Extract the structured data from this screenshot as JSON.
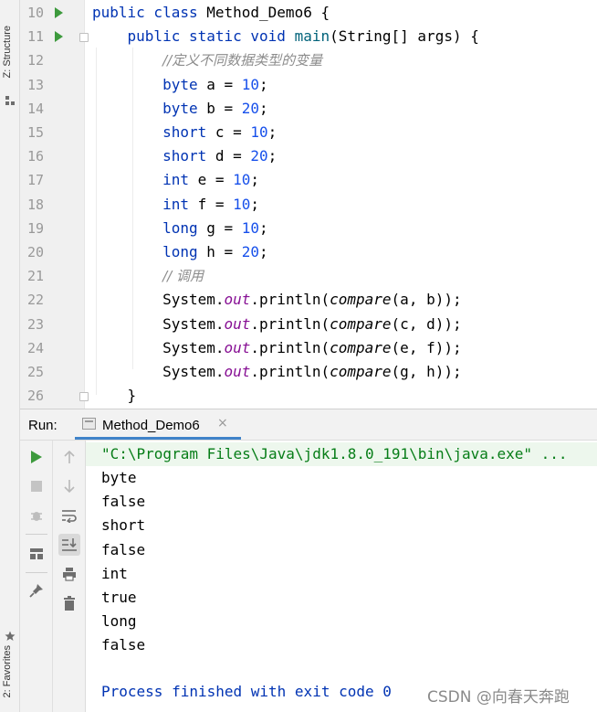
{
  "side_tabs": {
    "structure": "Z: Structure",
    "favorites": "2: Favorites"
  },
  "editor": {
    "lines": [
      {
        "num": "10",
        "run": true,
        "fold": false,
        "code": [
          {
            "t": "kw",
            "v": "public class "
          },
          {
            "t": "p",
            "v": "Method_Demo6 {"
          }
        ]
      },
      {
        "num": "11",
        "run": true,
        "fold": true,
        "code": [
          {
            "t": "p",
            "v": "    "
          },
          {
            "t": "kw",
            "v": "public static void "
          },
          {
            "t": "mth",
            "v": "main"
          },
          {
            "t": "p",
            "v": "(String[] args) {"
          }
        ]
      },
      {
        "num": "12",
        "run": false,
        "fold": false,
        "code": [
          {
            "t": "p",
            "v": "        "
          },
          {
            "t": "cmt",
            "v": "//定义不同数据类型的变量"
          }
        ]
      },
      {
        "num": "13",
        "run": false,
        "fold": false,
        "code": [
          {
            "t": "p",
            "v": "        "
          },
          {
            "t": "kw",
            "v": "byte "
          },
          {
            "t": "p",
            "v": "a = "
          },
          {
            "t": "num",
            "v": "10"
          },
          {
            "t": "p",
            "v": ";"
          }
        ]
      },
      {
        "num": "14",
        "run": false,
        "fold": false,
        "code": [
          {
            "t": "p",
            "v": "        "
          },
          {
            "t": "kw",
            "v": "byte "
          },
          {
            "t": "p",
            "v": "b = "
          },
          {
            "t": "num",
            "v": "20"
          },
          {
            "t": "p",
            "v": ";"
          }
        ]
      },
      {
        "num": "15",
        "run": false,
        "fold": false,
        "code": [
          {
            "t": "p",
            "v": "        "
          },
          {
            "t": "kw",
            "v": "short "
          },
          {
            "t": "p",
            "v": "c = "
          },
          {
            "t": "num",
            "v": "10"
          },
          {
            "t": "p",
            "v": ";"
          }
        ]
      },
      {
        "num": "16",
        "run": false,
        "fold": false,
        "code": [
          {
            "t": "p",
            "v": "        "
          },
          {
            "t": "kw",
            "v": "short "
          },
          {
            "t": "p",
            "v": "d = "
          },
          {
            "t": "num",
            "v": "20"
          },
          {
            "t": "p",
            "v": ";"
          }
        ]
      },
      {
        "num": "17",
        "run": false,
        "fold": false,
        "code": [
          {
            "t": "p",
            "v": "        "
          },
          {
            "t": "kw",
            "v": "int "
          },
          {
            "t": "p",
            "v": "e = "
          },
          {
            "t": "num",
            "v": "10"
          },
          {
            "t": "p",
            "v": ";"
          }
        ]
      },
      {
        "num": "18",
        "run": false,
        "fold": false,
        "code": [
          {
            "t": "p",
            "v": "        "
          },
          {
            "t": "kw",
            "v": "int "
          },
          {
            "t": "p",
            "v": "f = "
          },
          {
            "t": "num",
            "v": "10"
          },
          {
            "t": "p",
            "v": ";"
          }
        ]
      },
      {
        "num": "19",
        "run": false,
        "fold": false,
        "code": [
          {
            "t": "p",
            "v": "        "
          },
          {
            "t": "kw",
            "v": "long "
          },
          {
            "t": "p",
            "v": "g = "
          },
          {
            "t": "num",
            "v": "10"
          },
          {
            "t": "p",
            "v": ";"
          }
        ]
      },
      {
        "num": "20",
        "run": false,
        "fold": false,
        "code": [
          {
            "t": "p",
            "v": "        "
          },
          {
            "t": "kw",
            "v": "long "
          },
          {
            "t": "p",
            "v": "h = "
          },
          {
            "t": "num",
            "v": "20"
          },
          {
            "t": "p",
            "v": ";"
          }
        ]
      },
      {
        "num": "21",
        "run": false,
        "fold": false,
        "code": [
          {
            "t": "p",
            "v": "        "
          },
          {
            "t": "cmt",
            "v": "// 调用"
          }
        ]
      },
      {
        "num": "22",
        "run": false,
        "fold": false,
        "code": [
          {
            "t": "p",
            "v": "        System."
          },
          {
            "t": "fld",
            "v": "out"
          },
          {
            "t": "p",
            "v": ".println("
          },
          {
            "t": "imth",
            "v": "compare"
          },
          {
            "t": "p",
            "v": "(a, b));"
          }
        ]
      },
      {
        "num": "23",
        "run": false,
        "fold": false,
        "code": [
          {
            "t": "p",
            "v": "        System."
          },
          {
            "t": "fld",
            "v": "out"
          },
          {
            "t": "p",
            "v": ".println("
          },
          {
            "t": "imth",
            "v": "compare"
          },
          {
            "t": "p",
            "v": "(c, d));"
          }
        ]
      },
      {
        "num": "24",
        "run": false,
        "fold": false,
        "code": [
          {
            "t": "p",
            "v": "        System."
          },
          {
            "t": "fld",
            "v": "out"
          },
          {
            "t": "p",
            "v": ".println("
          },
          {
            "t": "imth",
            "v": "compare"
          },
          {
            "t": "p",
            "v": "(e, f));"
          }
        ]
      },
      {
        "num": "25",
        "run": false,
        "fold": false,
        "code": [
          {
            "t": "p",
            "v": "        System."
          },
          {
            "t": "fld",
            "v": "out"
          },
          {
            "t": "p",
            "v": ".println("
          },
          {
            "t": "imth",
            "v": "compare"
          },
          {
            "t": "p",
            "v": "(g, h));"
          }
        ]
      },
      {
        "num": "26",
        "run": false,
        "fold": true,
        "code": [
          {
            "t": "p",
            "v": "    }"
          }
        ]
      }
    ]
  },
  "run_panel": {
    "label": "Run:",
    "tab_title": "Method_Demo6",
    "tab_close": "×",
    "console": {
      "command": "\"C:\\Program Files\\Java\\jdk1.8.0_191\\bin\\java.exe\" ...",
      "output": [
        "byte",
        "false",
        "short",
        "false",
        "int",
        "true",
        "long",
        "false"
      ],
      "finished": "Process finished with exit code 0"
    }
  },
  "watermark": "CSDN @向春天奔跑",
  "colors": {
    "keyword": "#0033b3",
    "number": "#1750eb",
    "comment": "#8c8c8c",
    "field": "#871094",
    "run_green": "#3d9a3d",
    "command_bg": "#edf7ed",
    "tab_underline": "#4083c9"
  }
}
